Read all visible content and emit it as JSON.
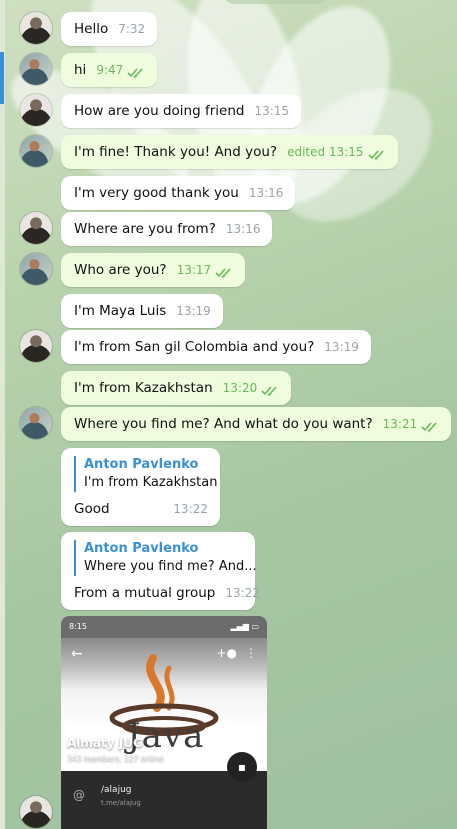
{
  "colors": {
    "incoming_bubble": "#ffffff",
    "outgoing_bubble": "#effdde",
    "accent": "#3a8fd6",
    "time_outgoing": "#6bb85a",
    "time_incoming": "#9aa3aa"
  },
  "messages": [
    {
      "text": "Hello",
      "time": "7:32"
    },
    {
      "text": "hi",
      "time": "9:47"
    },
    {
      "text": "How are you doing friend",
      "time": "13:15"
    },
    {
      "text": "I'm fine! Thank you! And you?",
      "time": "edited 13:15"
    },
    {
      "text": "I'm very good thank you",
      "time": "13:16"
    },
    {
      "text": "Where are you from?",
      "time": "13:16"
    },
    {
      "text": "Who are you?",
      "time": "13:17"
    },
    {
      "text": "I'm Maya Luis",
      "time": "13:19"
    },
    {
      "text": "I'm from San gil Colombia and you?",
      "time": "13:19"
    },
    {
      "text": "I'm from Kazakhstan",
      "time": "13:20"
    },
    {
      "text": "Where you find me? And what do you want?",
      "time": "13:21"
    }
  ],
  "replies": [
    {
      "reply_name": "Anton Pavlenko",
      "reply_quote": "I'm from Kazakhstan",
      "text": "Good",
      "time": "13:22"
    },
    {
      "reply_name": "Anton Pavlenko",
      "reply_quote": "Where you find me? And...",
      "text": "From a mutual group",
      "time": "13:22"
    }
  ],
  "screenshot": {
    "status_time": "8:15",
    "group_title": "Almaty JUG",
    "group_meta": "343 members, 127 online",
    "link_title": "/alajug",
    "link_url": "t.me/alajug",
    "logo_text": "Java"
  },
  "icons": {
    "read_receipt": "double-check-icon",
    "back": "back-arrow-icon",
    "add_user": "add-user-icon",
    "more": "more-icon",
    "fab": "chat-icon",
    "at": "at-icon"
  }
}
